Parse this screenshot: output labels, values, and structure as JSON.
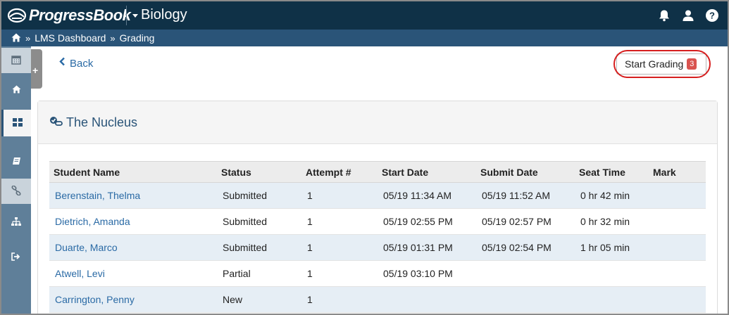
{
  "header": {
    "logo_text": "ProgressBook",
    "course": "Biology",
    "icons": [
      "bell-icon",
      "user-icon",
      "help-icon"
    ]
  },
  "breadcrumb": {
    "items": [
      "LMS Dashboard",
      "Grading"
    ],
    "separator": "»"
  },
  "sidebar": {
    "items": [
      "calendar-icon",
      "home-icon",
      "dashboard-icon",
      "book-icon",
      "link-icon",
      "sitemap-icon",
      "signout-icon"
    ],
    "add_label": "+"
  },
  "actions": {
    "back_label": "Back",
    "start_grading_label": "Start Grading",
    "start_grading_count": "3"
  },
  "panel": {
    "title": "The Nucleus"
  },
  "table": {
    "columns": [
      "Student Name",
      "Status",
      "Attempt #",
      "Start Date",
      "Submit Date",
      "Seat Time",
      "Mark"
    ],
    "rows": [
      {
        "name": "Berenstain, Thelma",
        "status": "Submitted",
        "attempt": "1",
        "start": "05/19 11:34 AM",
        "submit": "05/19 11:52 AM",
        "seat": "0 hr 42 min",
        "mark": ""
      },
      {
        "name": "Dietrich, Amanda",
        "status": "Submitted",
        "attempt": "1",
        "start": "05/19 02:55 PM",
        "submit": "05/19 02:57 PM",
        "seat": "0 hr 32 min",
        "mark": ""
      },
      {
        "name": "Duarte, Marco",
        "status": "Submitted",
        "attempt": "1",
        "start": "05/19 01:31 PM",
        "submit": "05/19 02:54 PM",
        "seat": "1 hr 05 min",
        "mark": ""
      },
      {
        "name": "Atwell, Levi",
        "status": "Partial",
        "attempt": "1",
        "start": "05/19 03:10 PM",
        "submit": "",
        "seat": "",
        "mark": ""
      },
      {
        "name": "Carrington, Penny",
        "status": "New",
        "attempt": "1",
        "start": "",
        "submit": "",
        "seat": "",
        "mark": ""
      }
    ]
  },
  "colors": {
    "topbar": "#0f3147",
    "breadcrumb": "#2a5478",
    "rail": "#5f7f99",
    "link": "#2a6aa5",
    "badge": "#d9534f",
    "highlight_ring": "#d61f1f"
  }
}
